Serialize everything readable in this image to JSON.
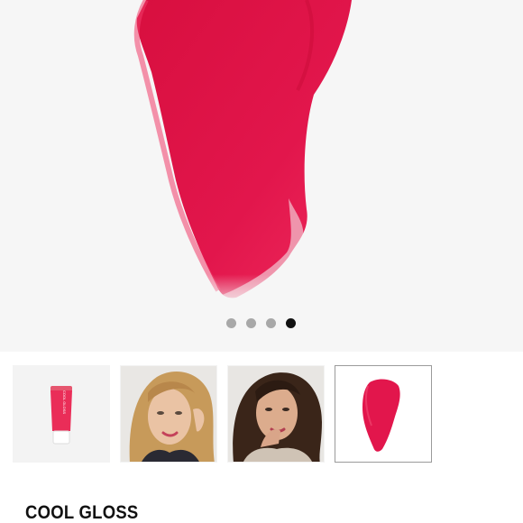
{
  "gallery": {
    "slide_count": 4,
    "active_slide": 4,
    "accent_color": "#e8174e",
    "dots": [
      {
        "state": "inactive"
      },
      {
        "state": "inactive"
      },
      {
        "state": "inactive"
      },
      {
        "state": "active"
      }
    ],
    "thumbnails": [
      {
        "icon": "lip-gloss-tube-icon",
        "selected": false
      },
      {
        "icon": "model-blonde-photo",
        "selected": false
      },
      {
        "icon": "model-brunette-photo",
        "selected": false
      },
      {
        "icon": "gloss-swatch-icon",
        "selected": true
      }
    ],
    "tube_brand_text": "COOL GLOSS"
  },
  "product": {
    "name": "COOL GLOSS"
  }
}
